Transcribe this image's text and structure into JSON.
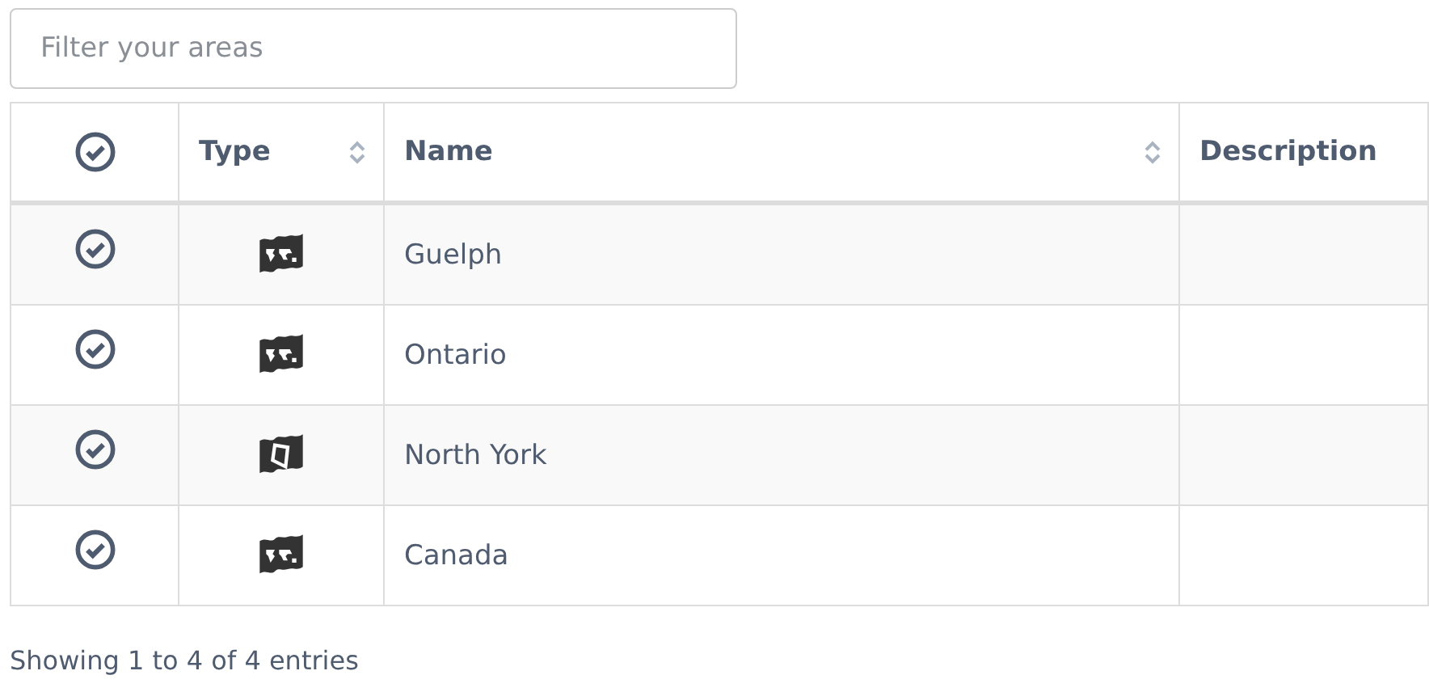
{
  "filter": {
    "placeholder": "Filter your areas"
  },
  "table": {
    "columns": [
      {
        "kind": "check"
      },
      {
        "label": "Type",
        "sortable": true
      },
      {
        "label": "Name",
        "sortable": true
      },
      {
        "label": "Description",
        "sortable": false
      }
    ],
    "rows": [
      {
        "kind": "world",
        "name": "Guelph"
      },
      {
        "kind": "world",
        "name": "Ontario"
      },
      {
        "kind": "polygon",
        "name": "North York"
      },
      {
        "kind": "world",
        "name": "Canada"
      }
    ]
  },
  "status": "Showing 1 to 4 of 4 entries"
}
